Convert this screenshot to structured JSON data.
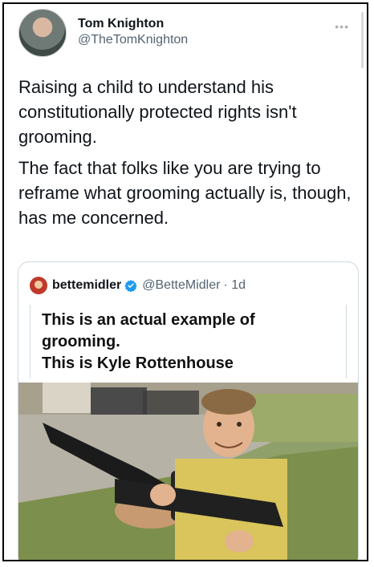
{
  "tweet": {
    "display_name": "Tom Knighton",
    "handle": "@TheTomKnighton",
    "body": [
      "Raising a child to understand his constitutionally protected rights isn't grooming.",
      "The fact that folks like you are trying to reframe what grooming actually is, though, has me concerned."
    ]
  },
  "quote": {
    "display_name": "bettemidler",
    "handle": "@BetteMidler",
    "time": "· 1d",
    "caption_lines": [
      "This is an actual example of",
      "grooming.",
      "This is Kyle Rottenhouse"
    ]
  },
  "icons": {
    "more": "more-options-icon",
    "verified": "verified-badge-icon"
  },
  "colors": {
    "verified": "#1d9bf0",
    "secondary_text": "#536471",
    "border": "#cfd9de"
  }
}
